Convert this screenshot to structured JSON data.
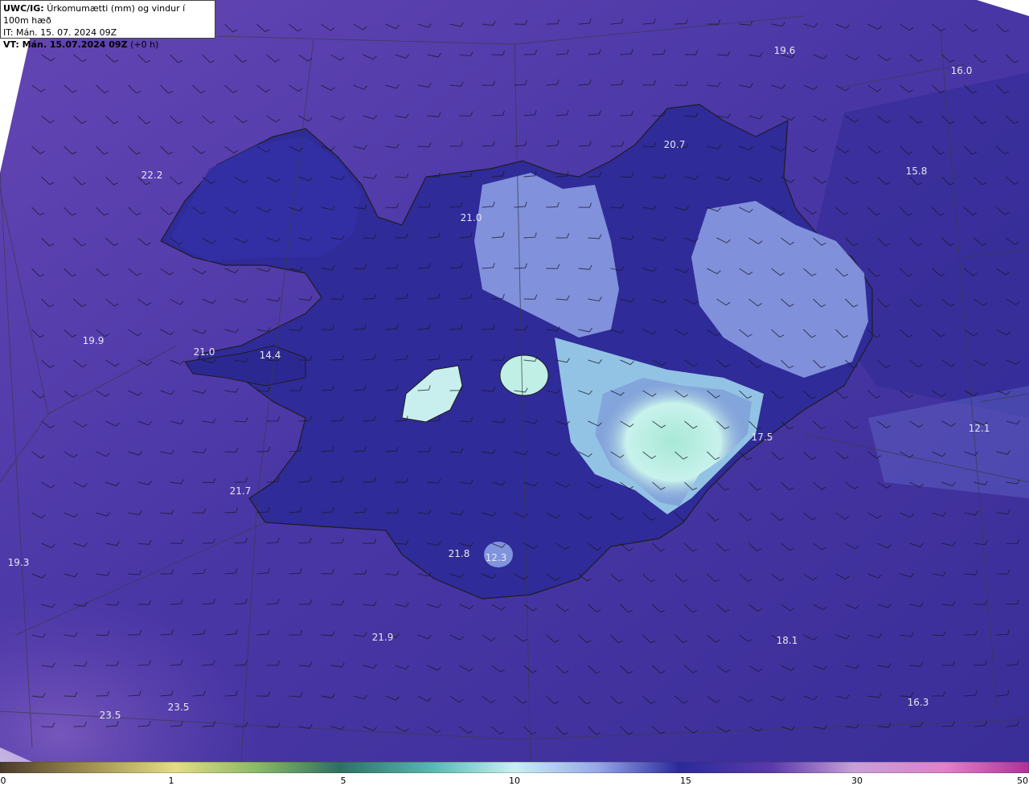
{
  "header": {
    "product": "UWC/IG:",
    "description": "Úrkomumætti (mm) og vindur í 100m hæð",
    "issue_time": "IT: Mán. 15. 07. 2024 09Z",
    "valid_label": "VT: Mán. 15.07.2024 09Z",
    "valid_offset": "(+0 h)"
  },
  "colors": {
    "sea_background": "#5a3fae",
    "deep_blue": "#2a2790",
    "glacier_light": "#b9f0e8",
    "coast_line": "#1e1e1e"
  },
  "values": [
    {
      "text": "19.6"
    },
    {
      "text": "16.0"
    },
    {
      "text": "20.7"
    },
    {
      "text": "15.8"
    },
    {
      "text": "22.2"
    },
    {
      "text": "21.0"
    },
    {
      "text": "19.9"
    },
    {
      "text": "21.0"
    },
    {
      "text": "14.4"
    },
    {
      "text": "17.5"
    },
    {
      "text": "12.1"
    },
    {
      "text": "21.7"
    },
    {
      "text": "19.3"
    },
    {
      "text": "21.8"
    },
    {
      "text": "12.3"
    },
    {
      "text": "21.9"
    },
    {
      "text": "18.1"
    },
    {
      "text": "16.3"
    },
    {
      "text": "23.5"
    },
    {
      "text": "23.5"
    }
  ],
  "legend": {
    "ticks": [
      "0",
      "1",
      "5",
      "10",
      "15",
      "30",
      "50"
    ]
  }
}
